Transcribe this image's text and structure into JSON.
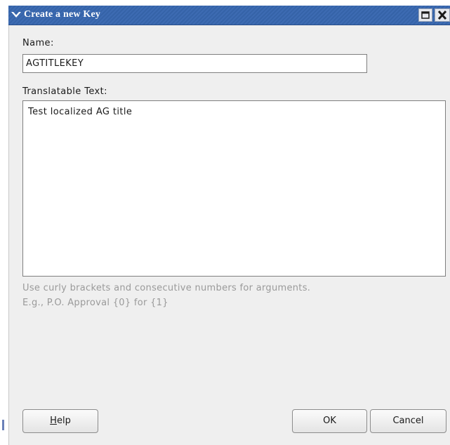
{
  "window": {
    "title": "Create a new Key"
  },
  "form": {
    "name_label": "Name:",
    "name_value": "AGTITLEKEY",
    "text_label": "Translatable Text:",
    "text_value": "Test localized AG title",
    "hint_line1": "Use curly brackets and consecutive numbers for arguments.",
    "hint_line2": "E.g., P.O. Approval {0} for {1}"
  },
  "buttons": {
    "help_label_mnemonic": "H",
    "help_label_rest": "elp",
    "ok_label": "OK",
    "cancel_label": "Cancel"
  },
  "icons": {
    "window_menu": "chevron-down-icon",
    "maximize": "maximize-icon",
    "close": "close-icon"
  },
  "colors": {
    "titlebar": "#3d6bb2",
    "dialog_bg": "#efefef",
    "hint_text": "#9a9a9a"
  }
}
